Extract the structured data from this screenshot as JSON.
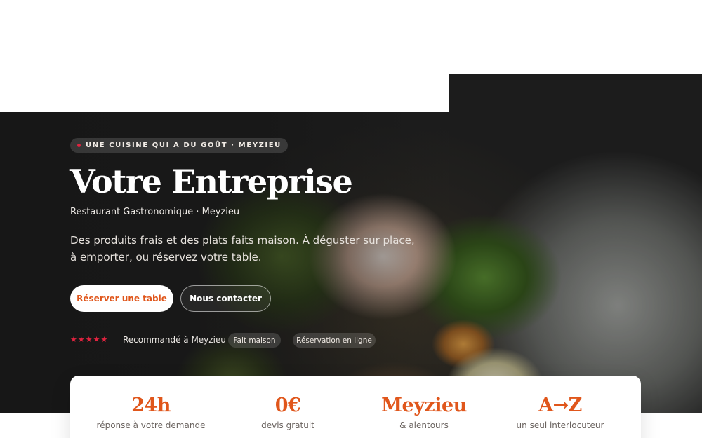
{
  "hero": {
    "eyebrow": "UNE CUISINE QUI A DU GOÛT · MEYZIEU",
    "title": "Votre Entreprise",
    "subtitle": "Restaurant Gastronomique · Meyzieu",
    "description": "Des produits frais et des plats faits maison. À déguster sur place, à emporter, ou réservez votre table.",
    "primary_cta": "Réserver une table",
    "secondary_cta": "Nous contacter",
    "rating_stars": "★★★★★",
    "recommendation": "Recommandé à Meyzieu",
    "chips": [
      "Fait maison",
      "Réservation en ligne"
    ]
  },
  "stats": [
    {
      "value": "24h",
      "label": "réponse à votre demande"
    },
    {
      "value": "0€",
      "label": "devis gratuit"
    },
    {
      "value": "Meyzieu",
      "label": "& alentours"
    },
    {
      "value": "A→Z",
      "label": "un seul interlocuteur"
    }
  ],
  "colors": {
    "accent": "#e0561b",
    "star": "#e0233f",
    "dot": "#e0233f"
  }
}
